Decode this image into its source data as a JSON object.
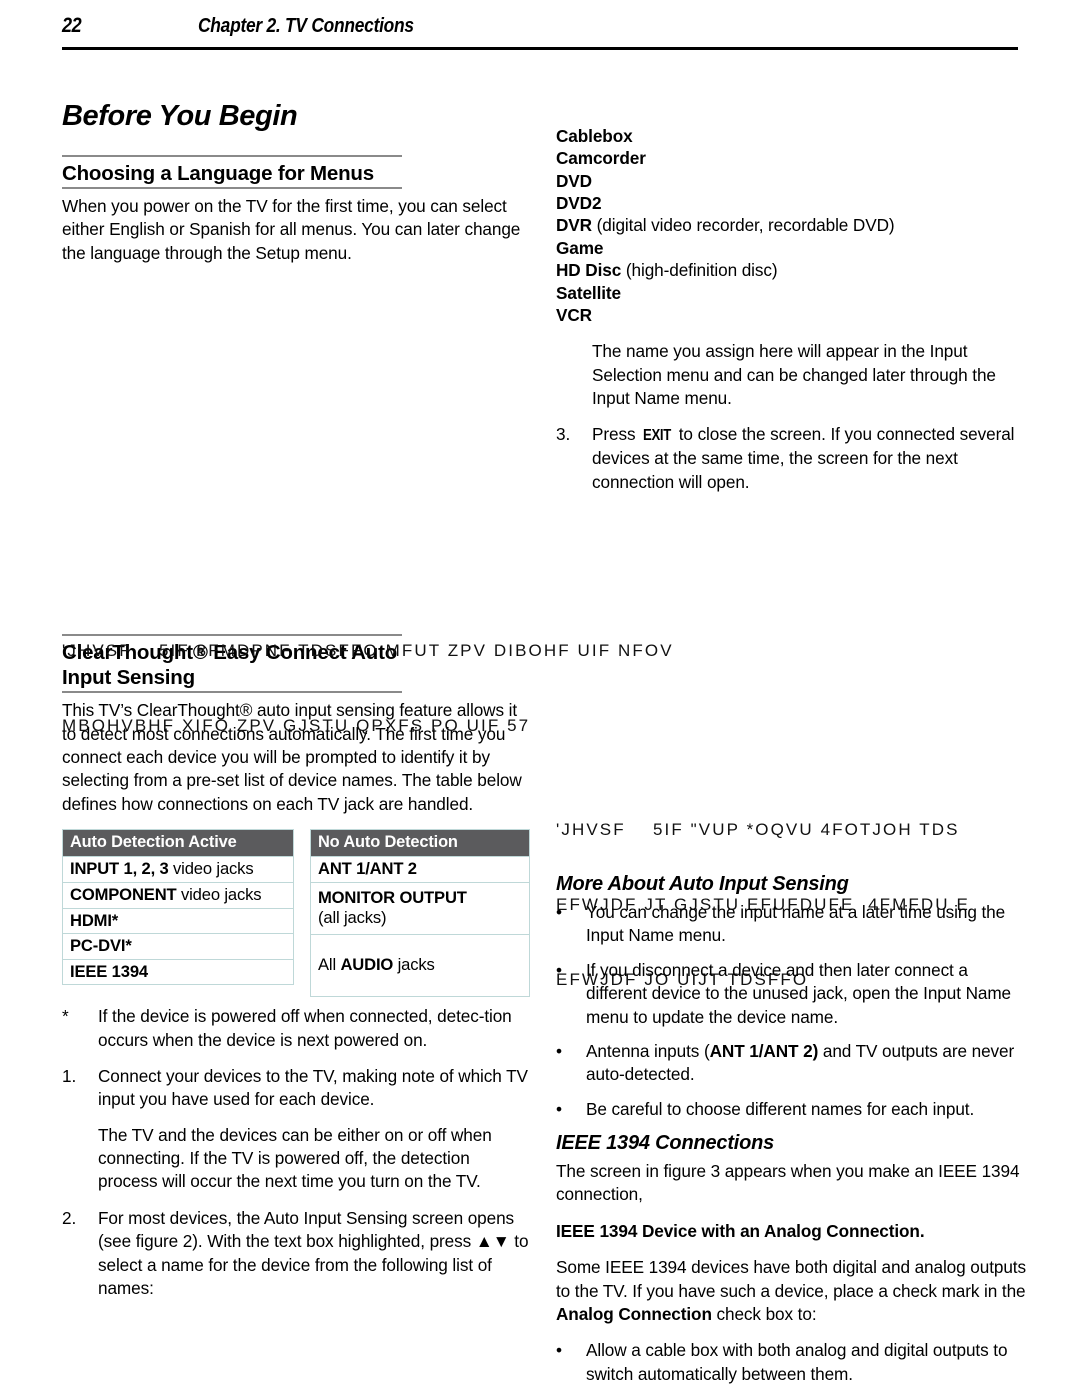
{
  "header": {
    "page_number": "22",
    "chapter": "Chapter 2. TV Connections"
  },
  "left_column": {
    "section_title": "Before You Begin",
    "subsection_1": {
      "heading": "Choosing a Language for Menus",
      "paragraph": "When you power on the TV for the first time, you can select either English or Spanish for all menus.  You can later change the language through the Setup menu."
    },
    "figure_caption_1": {
      "line1": "'JHVSF    5IF 8FMDPNF TDSFFO MFUT ZPV DIBOHF UIF NFOV",
      "line2": "MBOHVBHF XIFO ZPV GJSTU QPXFS PO UIF 57"
    },
    "subsection_2": {
      "heading": "ClearThought® Easy Connect Auto Input Sensing",
      "paragraph": "This TV’s ClearThought® auto input sensing feature allows it to detect most connections automatically.  The first time you connect each device you will be prompted to identify it by selecting from a pre-set list of device names.  The table below defines how connections on each TV jack are handled."
    },
    "table_left": {
      "header": "Auto Detection Active",
      "rows": [
        {
          "bold": "INPUT 1",
          "bold2": ", 2, 3",
          "rest": " video jacks"
        },
        {
          "bold": "COMPONENT",
          "bold2": "",
          "rest": " video jacks"
        },
        {
          "bold": "HDMI*",
          "bold2": "",
          "rest": ""
        },
        {
          "bold": "PC-DVI*",
          "bold2": "",
          "rest": ""
        },
        {
          "bold": "IEEE 1394",
          "bold2": "",
          "rest": ""
        }
      ]
    },
    "table_right": {
      "header": "No Auto Detection",
      "rows": [
        {
          "bold": "ANT 1/ANT 2",
          "rest": ""
        },
        {
          "bold": "MONITOR OUTPUT",
          "rest": "(all jacks)"
        },
        {
          "pre": "All ",
          "bold": "AUDIO",
          "rest": " jacks"
        }
      ]
    },
    "footnote": {
      "marker": "*",
      "text": "If the device is powered off when connected, detec-tion occurs when the device is next powered on."
    },
    "steps": [
      {
        "marker": "1.",
        "paragraphs": [
          "Connect your devices to the TV, making note of which TV input you have used for each device.",
          "The TV and the devices can be either on or off when connecting.  If the TV is powered off, the detection process will occur the next time you turn on the TV."
        ]
      },
      {
        "marker": "2.",
        "paragraphs": [
          "For most devices, the Auto Input Sensing screen opens (see figure 2).  With the text box highlighted, press ▲▼ to select a name for the device from the following list of names:"
        ]
      }
    ]
  },
  "right_column": {
    "device_names": [
      {
        "name": "Cablebox",
        "desc": ""
      },
      {
        "name": "Camcorder",
        "desc": ""
      },
      {
        "name": "DVD",
        "desc": ""
      },
      {
        "name": "DVD2",
        "desc": ""
      },
      {
        "name": "DVR",
        "desc": " (digital video recorder, recordable DVD)"
      },
      {
        "name": "Game",
        "desc": ""
      },
      {
        "name": "HD Disc",
        "desc": " (high-definition disc)"
      },
      {
        "name": "Satellite",
        "desc": ""
      },
      {
        "name": "VCR",
        "desc": ""
      }
    ],
    "note_paragraph": "The name you assign here will appear in the Input Selection menu and can be changed later through the Input Name menu.",
    "step_3": {
      "marker": "3.",
      "pre": "Press ",
      "key": "EXIT",
      "post": " to close the screen.  If you connected several devices at the same time, the screen for the next connection will open."
    },
    "figure_caption_2": {
      "line1": "'JHVSF    5IF \"VUP *OQVU 4FOTJOH TDS",
      "line2": "EFWJDF JT GJSTU EFUFDUFE  4FMFDU E",
      "line3": "EFWJDF JO UIJT TDSFFO"
    },
    "subsection_more": {
      "heading": "More About Auto Input Sensing",
      "bullets": [
        {
          "pre": "You can change the input name at a later time using the Input Name menu.",
          "bold": "",
          "post": ""
        },
        {
          "pre": "If you disconnect a device and then later connect a different device to the unused jack, open the Input Name menu to update the device name.",
          "bold": "",
          "post": ""
        },
        {
          "pre": "Antenna inputs (",
          "bold": "ANT 1/ANT 2)",
          "post": " and TV outputs are never auto-detected."
        },
        {
          "pre": "Be careful to choose different names for each input.",
          "bold": "",
          "post": ""
        }
      ]
    },
    "subsection_ieee": {
      "heading": "IEEE 1394 Connections",
      "paragraph_1": "The screen in figure 3 appears when you make an IEEE 1394 connection,",
      "bold_lead": "IEEE 1394 Device with an Analog Connection.",
      "paragraph_2_pre": "Some IEEE 1394 devices have both digital and analog outputs to the TV.  If you have such a device, place a check mark in the ",
      "paragraph_2_bold": "Analog Connection",
      "paragraph_2_post": " check box to:",
      "bullet_1": "Allow a cable box with both analog and digital outputs to switch automatically between them."
    }
  },
  "colors": {
    "table_header_bg": "#5b5b5d",
    "table_border": "#bfd8d8",
    "heading_rule": "#8a8a8a",
    "text": "#000000"
  }
}
